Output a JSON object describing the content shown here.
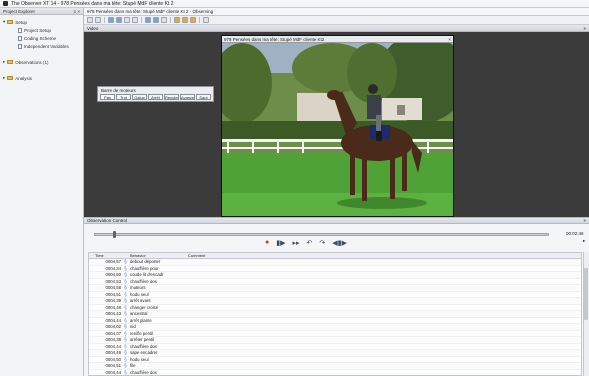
{
  "window": {
    "title": "The Observer XT 14 - 978 Pensées dans ma tête: Stupé MdF cliente Kt 2"
  },
  "left_panel": {
    "title": "Project Explorer",
    "controls": "≡ ×",
    "tree": [
      {
        "label": "Setup",
        "level": 0,
        "kind": "folder"
      },
      {
        "label": "Project Setup",
        "level": 1,
        "kind": "doc"
      },
      {
        "label": "Coding Scheme",
        "level": 1,
        "kind": "doc"
      },
      {
        "label": "Independent Variables",
        "level": 1,
        "kind": "doc"
      },
      {
        "label": "Observations (1)",
        "level": 0,
        "kind": "folder"
      },
      {
        "label": "Analysis",
        "level": 0,
        "kind": "folder"
      }
    ]
  },
  "document_tab": {
    "label": "978 Pensées dans ma tête: Stupé MdF cliente Kt 2 - Observing"
  },
  "video_panel": {
    "title": "Video",
    "close": "×",
    "frame_title": "978 Pensées dans ma tête: Stupé MdF cliente Kt2",
    "frame_close": "×"
  },
  "behaviors_box": {
    "title": "Barre de moteurs",
    "buttons": [
      "Pas",
      "Trot",
      "Galop",
      "Arrêt",
      "Reculer",
      "Avancer",
      "Saut"
    ]
  },
  "observation_panel": {
    "title": "Observation Control",
    "close": "×",
    "time": "00:02:46",
    "expand_icon_label": "▸"
  },
  "grid": {
    "headers": {
      "time": "Time",
      "behavior": "Behavior",
      "comment": "Comment"
    },
    "rows": [
      {
        "time": "0004,57",
        "behavior": "debout déporter"
      },
      {
        "time": "0004,34",
        "behavior": "chauffière pour"
      },
      {
        "time": "0004,50",
        "behavior": "coude lit d'encadr"
      },
      {
        "time": "0004,53",
        "behavior": "chauffière dos"
      },
      {
        "time": "0004,58",
        "behavior": "moteurs"
      },
      {
        "time": "0004,51",
        "behavior": "hodu seul"
      },
      {
        "time": "0004,39",
        "behavior": "arrêt avant"
      },
      {
        "time": "0004,48",
        "behavior": "changer croisé"
      },
      {
        "time": "0004,43",
        "behavior": "ancestral"
      },
      {
        "time": "0004,44",
        "behavior": "arrêt plante"
      },
      {
        "time": "0004,02",
        "behavior": "nid"
      },
      {
        "time": "0004,07",
        "behavior": "renifle pentil"
      },
      {
        "time": "0004,38",
        "behavior": "arrêter pentil"
      },
      {
        "time": "0004,44",
        "behavior": "chauffière dos"
      },
      {
        "time": "0004,49",
        "behavior": "sape encadrer"
      },
      {
        "time": "0004,50",
        "behavior": "hodu seul"
      },
      {
        "time": "0004,51",
        "behavior": "file"
      },
      {
        "time": "0004,44",
        "behavior": "chauffière dos"
      }
    ]
  },
  "icons": {
    "app": "app-icon",
    "record": "record-icon",
    "play": "play-icon",
    "step": "step-forward-icon",
    "undo": "undo-icon",
    "redo": "redo-icon",
    "frame": "frame-step-icon"
  }
}
